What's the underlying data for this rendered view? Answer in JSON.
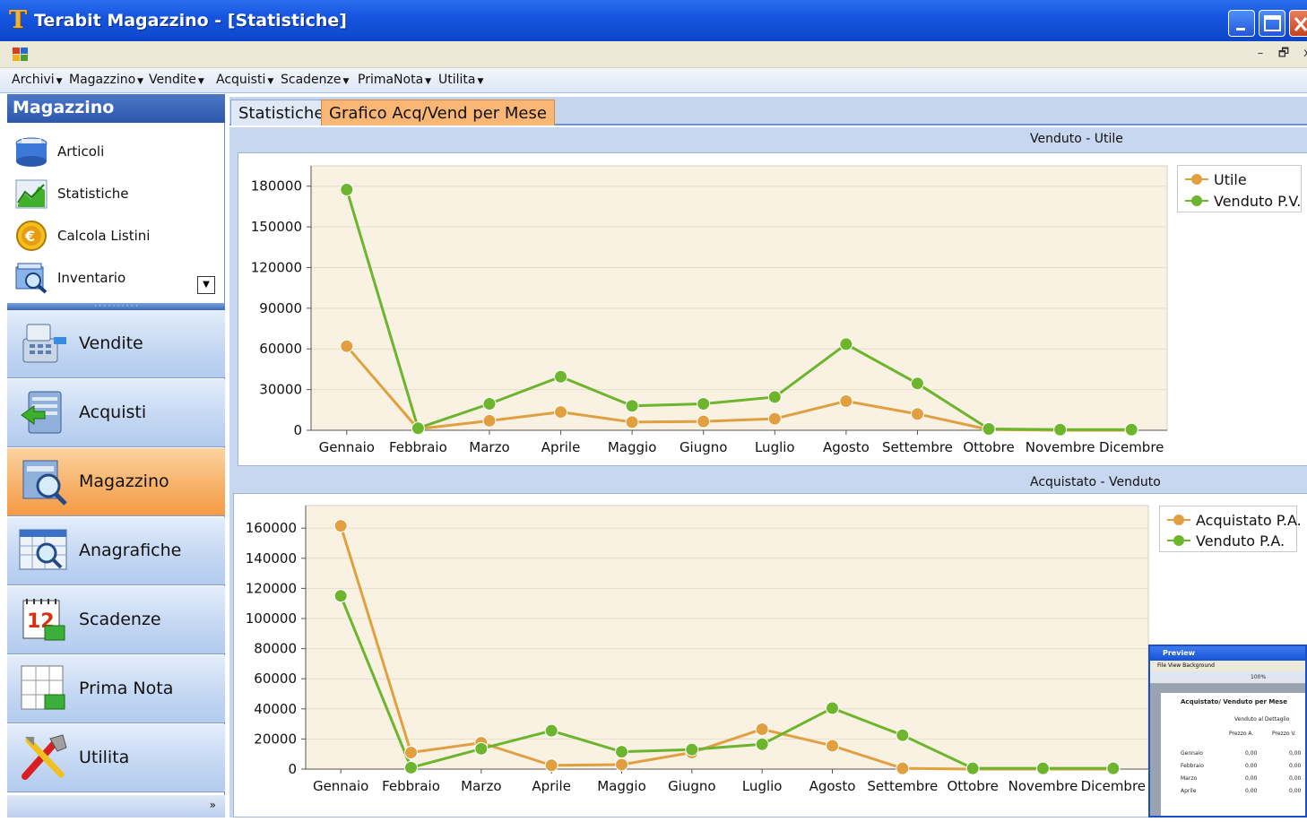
{
  "window": {
    "title": "Terabit Magazzino - [Statistiche]",
    "logo_letter": "T",
    "controls": [
      "minimize-icon",
      "maximize-icon",
      "close-icon"
    ]
  },
  "mdi": {
    "restore": "🗗",
    "minimize": "–",
    "close": "x"
  },
  "menubar": [
    {
      "label": "Archivi"
    },
    {
      "label": "Magazzino"
    },
    {
      "label": "Vendite"
    },
    {
      "label": "Acquisti"
    },
    {
      "label": "Scadenze"
    },
    {
      "label": "PrimaNota"
    },
    {
      "label": "Utilita"
    }
  ],
  "sidebar": {
    "header": "Magazzino",
    "subitems": [
      {
        "label": "Articoli",
        "icon": "box-icon"
      },
      {
        "label": "Statistiche",
        "icon": "chart-icon"
      },
      {
        "label": "Calcola Listini",
        "icon": "euro-coin-icon"
      },
      {
        "label": "Inventario",
        "icon": "inventory-icon"
      }
    ],
    "buttons": [
      {
        "label": "Vendite",
        "icon": "cash-register-icon",
        "active": false
      },
      {
        "label": "Acquisti",
        "icon": "purchase-icon",
        "active": false
      },
      {
        "label": "Magazzino",
        "icon": "warehouse-search-icon",
        "active": true
      },
      {
        "label": "Anagrafiche",
        "icon": "registry-icon",
        "active": false
      },
      {
        "label": "Scadenze",
        "icon": "calendar-icon",
        "active": false
      },
      {
        "label": "Prima Nota",
        "icon": "ledger-icon",
        "active": false
      },
      {
        "label": "Utilita",
        "icon": "tools-icon",
        "active": false
      }
    ]
  },
  "tabs": [
    {
      "label": "Statistiche",
      "active": false
    },
    {
      "label": "Grafico Acq/Vend per Mese",
      "active": true
    }
  ],
  "colors": {
    "orange": "#e0a040",
    "green": "#6cb52c",
    "plot_bg": "#f9f1e2",
    "accent": "#f59a45"
  },
  "chart_data": [
    {
      "type": "line",
      "title": "Venduto - Utile",
      "categories": [
        "Gennaio",
        "Febbraio",
        "Marzo",
        "Aprile",
        "Maggio",
        "Giugno",
        "Luglio",
        "Agosto",
        "Settembre",
        "Ottobre",
        "Novembre",
        "Dicembre"
      ],
      "ylim": [
        0,
        195000
      ],
      "yticks": [
        0,
        30000,
        60000,
        90000,
        120000,
        150000,
        180000
      ],
      "legend_position": "top-right",
      "series": [
        {
          "name": "Utile",
          "color": "#e0a040",
          "values": [
            62000,
            1000,
            7000,
            13500,
            6000,
            6500,
            8500,
            21500,
            12000,
            500,
            0,
            0
          ]
        },
        {
          "name": "Venduto P.V.",
          "color": "#6cb52c",
          "values": [
            177500,
            1500,
            19500,
            39500,
            18000,
            19500,
            24500,
            63500,
            34500,
            1000,
            500,
            500
          ]
        }
      ]
    },
    {
      "type": "line",
      "title": "Acquistato - Venduto",
      "categories": [
        "Gennaio",
        "Febbraio",
        "Marzo",
        "Aprile",
        "Maggio",
        "Giugno",
        "Luglio",
        "Agosto",
        "Settembre",
        "Ottobre",
        "Novembre",
        "Dicembre"
      ],
      "ylim": [
        0,
        175000
      ],
      "yticks": [
        0,
        20000,
        40000,
        60000,
        80000,
        100000,
        120000,
        140000,
        160000
      ],
      "legend_position": "top-right",
      "series": [
        {
          "name": "Acquistato P.A.",
          "color": "#e0a040",
          "values": [
            161500,
            11000,
            17500,
            2500,
            3000,
            11000,
            26500,
            15500,
            500,
            0,
            0,
            0
          ]
        },
        {
          "name": "Venduto P.A.",
          "color": "#6cb52c",
          "values": [
            115000,
            1000,
            13500,
            25500,
            11500,
            13000,
            16500,
            40500,
            22500,
            500,
            500,
            500
          ]
        }
      ]
    }
  ],
  "preview": {
    "title": "Preview",
    "menu": "File  View  Background",
    "zoom": "100%",
    "report_title": "Acquistato/ Venduto per Mese",
    "subtitle": "Venduto al Dettaglio",
    "col_a": "Prezzo A.",
    "col_v": "Prezzo V.",
    "rows": [
      {
        "month": "Gennaio",
        "a": "0,00",
        "v": "0,00"
      },
      {
        "month": "Febbraio",
        "a": "0,00",
        "v": "0,00"
      },
      {
        "month": "Marzo",
        "a": "0,00",
        "v": "0,00"
      },
      {
        "month": "Aprile",
        "a": "0,00",
        "v": "0,00"
      }
    ]
  }
}
